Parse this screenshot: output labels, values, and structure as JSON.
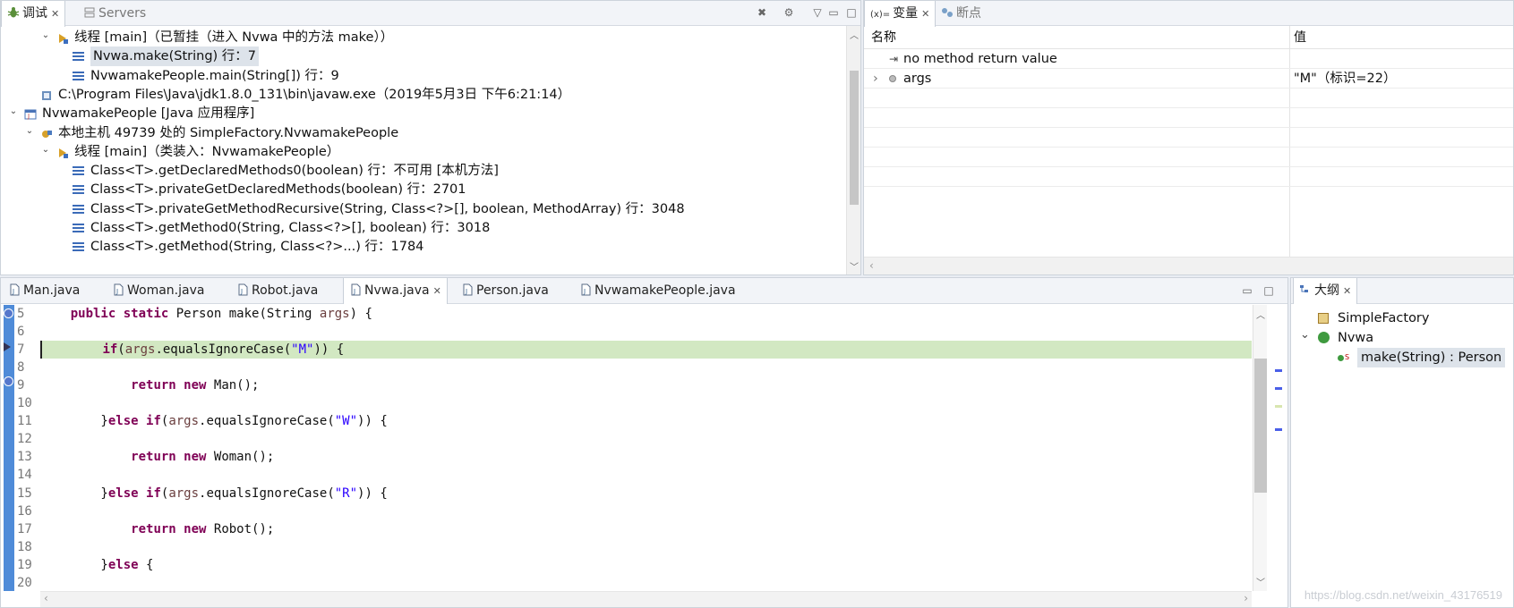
{
  "debug_view": {
    "tabs": [
      {
        "label": "调试",
        "active": true
      },
      {
        "label": "Servers",
        "active": false
      }
    ],
    "tree": [
      {
        "level": 2,
        "expanded": true,
        "icon": "thread-suspended-icon",
        "text": "线程 [main]（已暂挂（进入 Nvwa 中的方法 make））"
      },
      {
        "level": 3,
        "icon": "stack-frame-icon",
        "text": "Nvwa.make(String) 行：7",
        "selected": true
      },
      {
        "level": 3,
        "icon": "stack-frame-icon",
        "text": "NvwamakePeople.main(String[]) 行：9"
      },
      {
        "level": 1,
        "icon": "process-icon",
        "text": "C:\\Program Files\\Java\\jdk1.8.0_131\\bin\\javaw.exe（2019年5月3日 下午6:21:14）"
      },
      {
        "level": 0,
        "expanded": true,
        "icon": "java-app-icon",
        "text": "NvwamakePeople [Java 应用程序]"
      },
      {
        "level": 1,
        "expanded": true,
        "icon": "debug-target-icon",
        "text": "本地主机 49739 处的 SimpleFactory.NvwamakePeople"
      },
      {
        "level": 2,
        "expanded": true,
        "icon": "thread-suspended-icon",
        "text": "线程 [main]（类装入：NvwamakePeople）"
      },
      {
        "level": 3,
        "icon": "stack-frame-icon",
        "text": "Class<T>.getDeclaredMethods0(boolean) 行：不可用 [本机方法]"
      },
      {
        "level": 3,
        "icon": "stack-frame-icon",
        "text": "Class<T>.privateGetDeclaredMethods(boolean) 行：2701"
      },
      {
        "level": 3,
        "icon": "stack-frame-icon",
        "text": "Class<T>.privateGetMethodRecursive(String, Class<?>[], boolean, MethodArray) 行：3048"
      },
      {
        "level": 3,
        "icon": "stack-frame-icon",
        "text": "Class<T>.getMethod0(String, Class<?>[], boolean) 行：3018"
      },
      {
        "level": 3,
        "icon": "stack-frame-icon",
        "text": "Class<T>.getMethod(String, Class<?>...) 行：1784"
      }
    ]
  },
  "variables_view": {
    "tabs": [
      {
        "label": "变量",
        "active": true
      },
      {
        "label": "断点",
        "active": false
      }
    ],
    "col_name": "名称",
    "col_value": "值",
    "rows": [
      {
        "name": "no method return value",
        "value": "",
        "icon": "return-icon",
        "expandable": false
      },
      {
        "name": "args",
        "value": "\"M\"（标识=22）",
        "icon": "local-var-icon",
        "expandable": true
      }
    ]
  },
  "editor": {
    "tabs": [
      {
        "label": "Man.java",
        "active": false
      },
      {
        "label": "Woman.java",
        "active": false
      },
      {
        "label": "Robot.java",
        "active": false
      },
      {
        "label": "Nvwa.java",
        "active": true
      },
      {
        "label": "Person.java",
        "active": false
      },
      {
        "label": "NvwamakePeople.java",
        "active": false
      }
    ],
    "current_line": 7,
    "lines": [
      {
        "n": "5",
        "tokens": [
          [
            "    ",
            ""
          ],
          [
            "public",
            "kw"
          ],
          [
            " ",
            ""
          ],
          [
            "static",
            "kw"
          ],
          [
            " Person make(String ",
            ""
          ],
          [
            "args",
            "var"
          ],
          [
            ") {",
            ""
          ]
        ]
      },
      {
        "n": "6",
        "tokens": []
      },
      {
        "n": "7",
        "tokens": [
          [
            "        ",
            ""
          ],
          [
            "if",
            "kw"
          ],
          [
            "(",
            ""
          ],
          [
            "args",
            "var"
          ],
          [
            ".equalsIgnoreCase(",
            ""
          ],
          [
            "\"M\"",
            "str"
          ],
          [
            ")) {",
            ""
          ]
        ]
      },
      {
        "n": "8",
        "tokens": []
      },
      {
        "n": "9",
        "tokens": [
          [
            "            ",
            ""
          ],
          [
            "return",
            "kw"
          ],
          [
            " ",
            ""
          ],
          [
            "new",
            "kw"
          ],
          [
            " Man();",
            ""
          ]
        ]
      },
      {
        "n": "10",
        "tokens": []
      },
      {
        "n": "11",
        "tokens": [
          [
            "        }",
            ""
          ],
          [
            "else",
            "kw"
          ],
          [
            " ",
            ""
          ],
          [
            "if",
            "kw"
          ],
          [
            "(",
            ""
          ],
          [
            "args",
            "var"
          ],
          [
            ".equalsIgnoreCase(",
            ""
          ],
          [
            "\"W\"",
            "str"
          ],
          [
            ")) {",
            ""
          ]
        ]
      },
      {
        "n": "12",
        "tokens": []
      },
      {
        "n": "13",
        "tokens": [
          [
            "            ",
            ""
          ],
          [
            "return",
            "kw"
          ],
          [
            " ",
            ""
          ],
          [
            "new",
            "kw"
          ],
          [
            " Woman();",
            ""
          ]
        ]
      },
      {
        "n": "14",
        "tokens": []
      },
      {
        "n": "15",
        "tokens": [
          [
            "        }",
            ""
          ],
          [
            "else",
            "kw"
          ],
          [
            " ",
            ""
          ],
          [
            "if",
            "kw"
          ],
          [
            "(",
            ""
          ],
          [
            "args",
            "var"
          ],
          [
            ".equalsIgnoreCase(",
            ""
          ],
          [
            "\"R\"",
            "str"
          ],
          [
            ")) {",
            ""
          ]
        ]
      },
      {
        "n": "16",
        "tokens": []
      },
      {
        "n": "17",
        "tokens": [
          [
            "            ",
            ""
          ],
          [
            "return",
            "kw"
          ],
          [
            " ",
            ""
          ],
          [
            "new",
            "kw"
          ],
          [
            " Robot();",
            ""
          ]
        ]
      },
      {
        "n": "18",
        "tokens": []
      },
      {
        "n": "19",
        "tokens": [
          [
            "        }",
            ""
          ],
          [
            "else",
            "kw"
          ],
          [
            " {",
            ""
          ]
        ]
      },
      {
        "n": "20",
        "tokens": []
      }
    ]
  },
  "outline_view": {
    "tab_label": "大纲",
    "items": [
      {
        "label": "SimpleFactory",
        "icon": "package-icon",
        "level": 0
      },
      {
        "label": "Nvwa",
        "icon": "class-icon",
        "level": 0,
        "expanded": true
      },
      {
        "label": "make(String) : Person",
        "icon": "static-method-icon",
        "level": 1,
        "selected": true
      }
    ]
  },
  "watermark": "https://blog.csdn.net/weixin_43176519",
  "colors": {
    "keyword": "#7f0055",
    "string": "#2a00ff",
    "local_var": "#6a3e3e",
    "current_line_highlight": "#d2e8c2",
    "selection": "#dde3ea"
  }
}
